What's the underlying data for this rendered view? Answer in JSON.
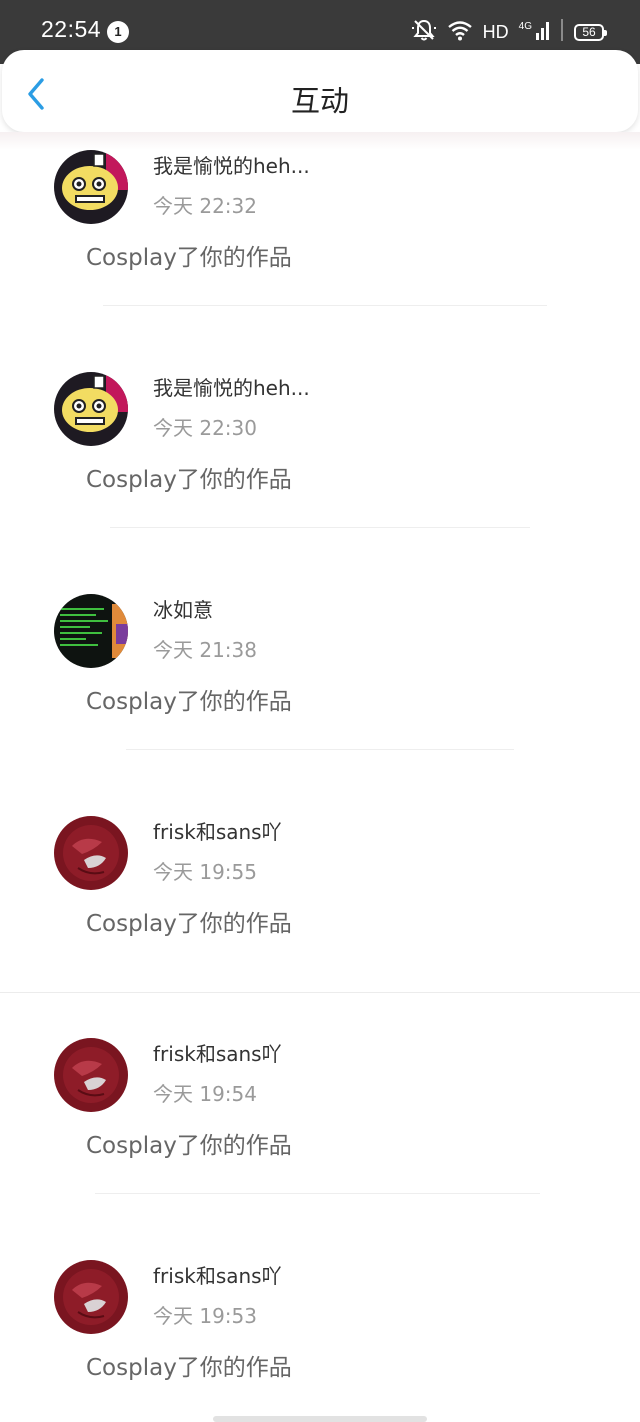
{
  "status_bar": {
    "time": "22:54",
    "notification_count": "1",
    "network_label": "HD",
    "network_type": "4G",
    "battery": "56"
  },
  "header": {
    "title": "互动",
    "back_icon": "chevron-left-icon",
    "accent_color": "#2b9de4"
  },
  "items": [
    {
      "name": "我是愉悦的heh...",
      "time": "今天 22:32",
      "action": "Cosplay了你的作品",
      "avatar": "cartoon-face-avatar"
    },
    {
      "name": "我是愉悦的heh...",
      "time": "今天 22:30",
      "action": "Cosplay了你的作品",
      "avatar": "cartoon-face-avatar"
    },
    {
      "name": "冰如意",
      "time": "今天 21:38",
      "action": "Cosplay了你的作品",
      "avatar": "terminal-screen-avatar"
    },
    {
      "name": "frisk和sans吖",
      "time": "今天 19:55",
      "action": "Cosplay了你的作品",
      "avatar": "red-character-avatar"
    },
    {
      "name": "frisk和sans吖",
      "time": "今天 19:54",
      "action": "Cosplay了你的作品",
      "avatar": "red-character-avatar"
    },
    {
      "name": "frisk和sans吖",
      "time": "今天 19:53",
      "action": "Cosplay了你的作品",
      "avatar": "red-character-avatar"
    }
  ]
}
